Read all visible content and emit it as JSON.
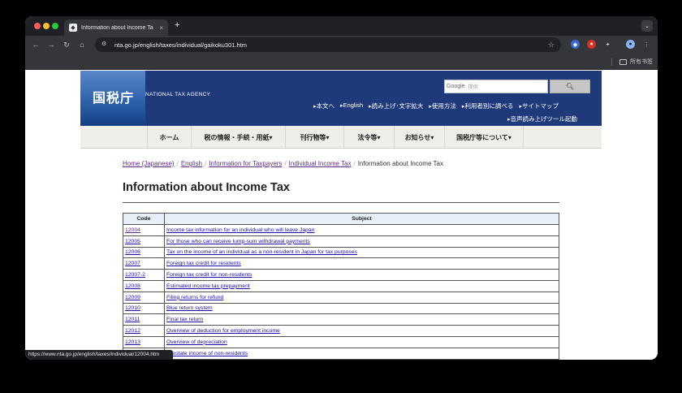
{
  "browser": {
    "tab_title": "Information about Income Ta",
    "tab_close": "×",
    "new_tab": "+",
    "tab_menu": "⌄",
    "url": "nta.go.jp/english/taxes/individual/gaikoku301.htm",
    "bookmarks_folder": "所有书签",
    "status_url": "https://www.nta.go.jp/english/taxes/individual/12004.htm"
  },
  "header": {
    "site_name": "国税庁",
    "site_name_en": "NATIONAL TAX AGENCY",
    "search_brand": "Google",
    "search_placeholder": "提供",
    "utility_links": [
      "本文へ",
      "English",
      "読み上げ･文字拡大",
      "使用方法",
      "利用者別に調べる",
      "サイトマップ"
    ],
    "voice_link": "音声読み上げツール起動"
  },
  "nav": {
    "items": [
      "ホーム",
      "税の情報・手続・用紙▾",
      "刊行物等▾",
      "法令等▾",
      "お知らせ▾",
      "国税庁等について▾"
    ]
  },
  "breadcrumb": {
    "home": "Home (Japanese)",
    "english": "English",
    "taxpayers": "Information for Taxpayers",
    "individual": "Individual Income Tax",
    "current": "Information about Income Tax",
    "sep": "/"
  },
  "main": {
    "title": "Information about Income Tax",
    "table": {
      "headers": [
        "Code",
        "Subject"
      ],
      "rows": [
        {
          "code": "12004",
          "subject": "Income tax information for an individual who will leave Japan"
        },
        {
          "code": "12005",
          "subject": "For those who can receive lump-sum withdrawal payments"
        },
        {
          "code": "12006",
          "subject": "Tax on the income of an individual as a non-resident in Japan for tax purposes"
        },
        {
          "code": "12007",
          "subject": "Foreign tax credit for residents"
        },
        {
          "code": "12007-2",
          "subject": "Foreign tax credit for non-residents"
        },
        {
          "code": "12008",
          "subject": "Estimated income tax prepayment"
        },
        {
          "code": "12009",
          "subject": "Filing returns for refund"
        },
        {
          "code": "12010",
          "subject": "Blue return system"
        },
        {
          "code": "12011",
          "subject": "Final tax return"
        },
        {
          "code": "12012",
          "subject": "Overview of deduction for employment income"
        },
        {
          "code": "12013",
          "subject": "Overview of depreciation"
        },
        {
          "code": "",
          "subject": "al estate income of non-residents"
        }
      ]
    }
  }
}
